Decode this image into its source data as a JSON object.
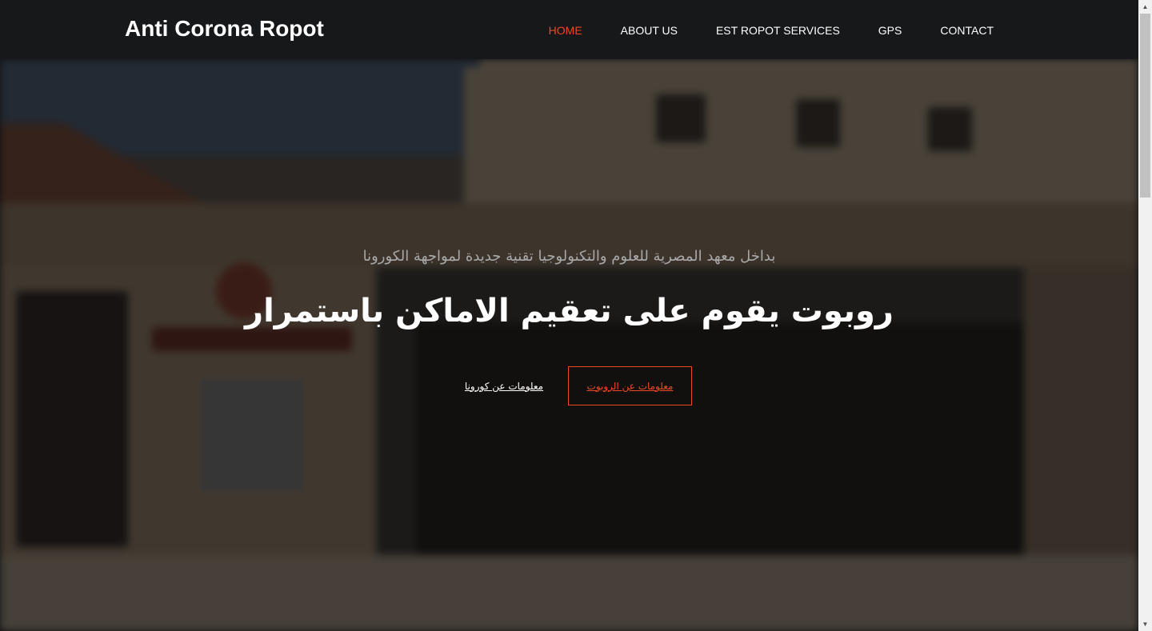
{
  "brand": {
    "name": "Anti Corona Ropot"
  },
  "nav": {
    "items": [
      {
        "label": "HOME",
        "active": true
      },
      {
        "label": "ABOUT US",
        "active": false
      },
      {
        "label": "EST ROPOT SERVICES",
        "active": false
      },
      {
        "label": "GPS",
        "active": false
      },
      {
        "label": "CONTACT",
        "active": false
      }
    ]
  },
  "hero": {
    "subtitle": "بداخل معهد المصرية للعلوم والتكنولوجيا تقنية جديدة لمواجهة الكورونا",
    "headline": "روبوت يقوم على تعقيم الاماكن باستمرار",
    "primary_button": "معلومات عن الروبوت",
    "secondary_button": "معلومات عن كورونا"
  },
  "colors": {
    "accent": "#ef4826",
    "navbar_bg": "#17181a",
    "text": "#ffffff"
  }
}
